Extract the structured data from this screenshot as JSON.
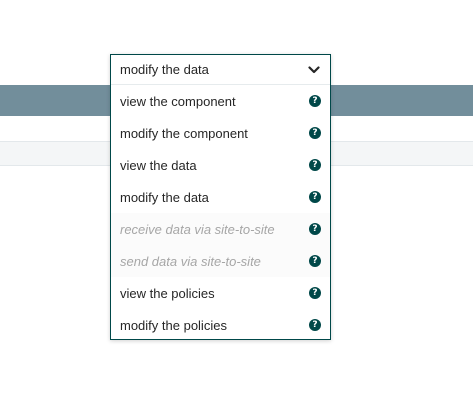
{
  "dropdown": {
    "selected_label": "modify the data",
    "options": [
      {
        "label": "view the component",
        "disabled": false
      },
      {
        "label": "modify the component",
        "disabled": false
      },
      {
        "label": "view the data",
        "disabled": false
      },
      {
        "label": "modify the data",
        "disabled": false
      },
      {
        "label": "receive data via site-to-site",
        "disabled": true
      },
      {
        "label": "send data via site-to-site",
        "disabled": true
      },
      {
        "label": "view the policies",
        "disabled": false
      },
      {
        "label": "modify the policies",
        "disabled": false
      }
    ],
    "help_glyph": "?",
    "chevron_icon": "chevron-down-icon",
    "help_icon": "question-circle-icon"
  },
  "colors": {
    "header_bar": "#728e9b",
    "accent": "#004849",
    "disabled_text": "#a6a6a6"
  }
}
